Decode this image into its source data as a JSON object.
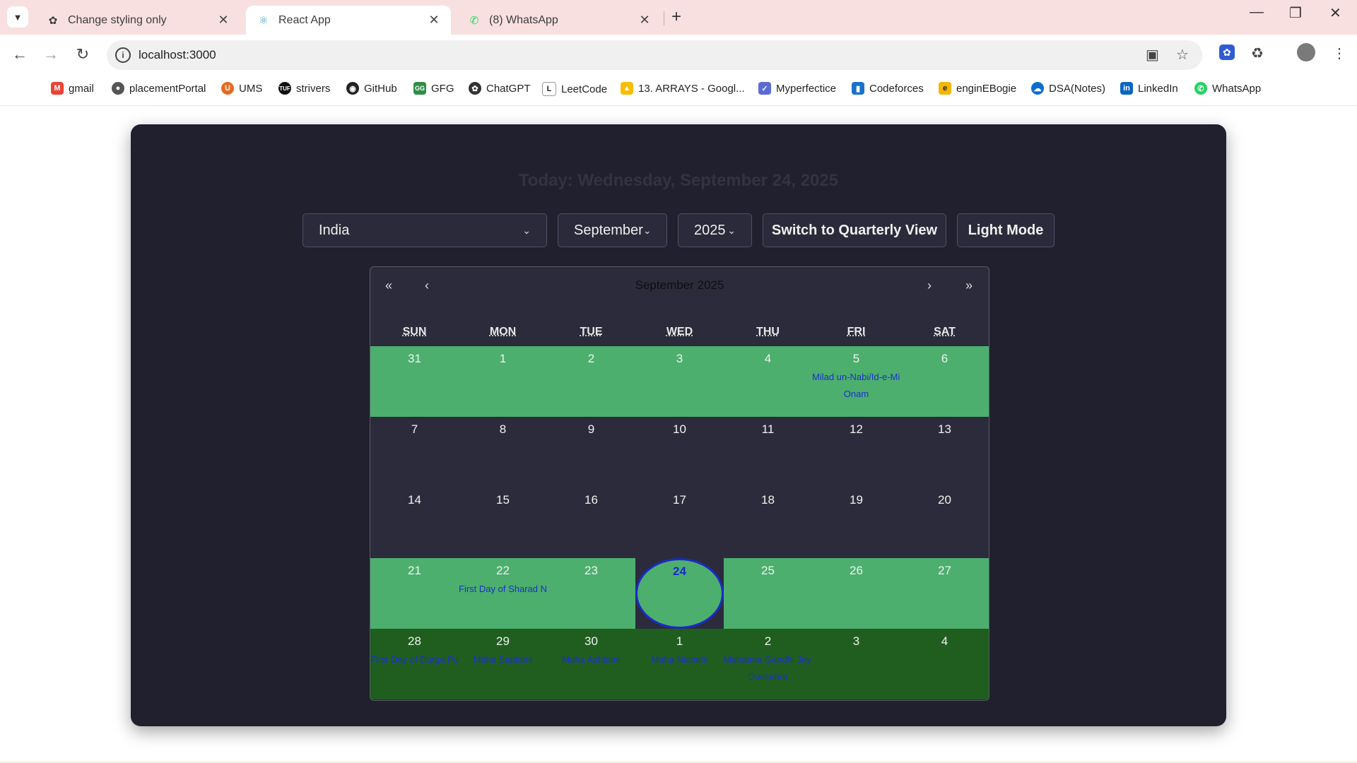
{
  "browser": {
    "tabs": [
      {
        "title": "Change styling only",
        "icon": "chatgpt-icon",
        "active": false
      },
      {
        "title": "React App",
        "icon": "react-icon",
        "active": true
      },
      {
        "title": "(8) WhatsApp",
        "icon": "whatsapp-icon",
        "active": false
      }
    ],
    "url": "localhost:3000",
    "bookmarks": [
      {
        "label": "gmail",
        "icon": "gmail-icon"
      },
      {
        "label": "placementPortal",
        "icon": "globe-icon"
      },
      {
        "label": "UMS",
        "icon": "ums-icon"
      },
      {
        "label": "strivers",
        "icon": "tuf-icon"
      },
      {
        "label": "GitHub",
        "icon": "github-icon"
      },
      {
        "label": "GFG",
        "icon": "gfg-icon"
      },
      {
        "label": "ChatGPT",
        "icon": "chatgpt-icon"
      },
      {
        "label": "LeetCode",
        "icon": "leetcode-icon"
      },
      {
        "label": "13. ARRAYS - Googl...",
        "icon": "google-drive-icon"
      },
      {
        "label": "Myperfectice",
        "icon": "myperfectice-icon"
      },
      {
        "label": "Codeforces",
        "icon": "codeforces-icon"
      },
      {
        "label": "enginEBogie",
        "icon": "enginebogie-icon"
      },
      {
        "label": "DSA(Notes)",
        "icon": "onedrive-icon"
      },
      {
        "label": "LinkedIn",
        "icon": "linkedin-icon"
      },
      {
        "label": "WhatsApp",
        "icon": "whatsapp-icon"
      }
    ]
  },
  "app": {
    "today_text": "Today: Wednesday, September 24, 2025",
    "country": "India",
    "month": "September",
    "year": "2025",
    "view_button": "Switch to Quarterly View",
    "theme_button": "Light Mode"
  },
  "calendar": {
    "title": "September 2025",
    "nav": {
      "prev_year": "«",
      "prev_month": "‹",
      "next_month": "›",
      "next_year": "»"
    },
    "weekdays": [
      "SUN",
      "MON",
      "TUE",
      "WED",
      "THU",
      "FRI",
      "SAT"
    ],
    "weeks": [
      {
        "style": "green",
        "days": [
          {
            "num": "31",
            "events": []
          },
          {
            "num": "1",
            "events": []
          },
          {
            "num": "2",
            "events": []
          },
          {
            "num": "3",
            "events": []
          },
          {
            "num": "4",
            "events": []
          },
          {
            "num": "5",
            "events": [
              "Milad un-Nabi/Id-e-Milad",
              "Onam"
            ]
          },
          {
            "num": "6",
            "events": []
          }
        ]
      },
      {
        "style": "plain",
        "days": [
          {
            "num": "7",
            "events": []
          },
          {
            "num": "8",
            "events": []
          },
          {
            "num": "9",
            "events": []
          },
          {
            "num": "10",
            "events": []
          },
          {
            "num": "11",
            "events": []
          },
          {
            "num": "12",
            "events": []
          },
          {
            "num": "13",
            "events": []
          }
        ]
      },
      {
        "style": "plain",
        "days": [
          {
            "num": "14",
            "events": []
          },
          {
            "num": "15",
            "events": []
          },
          {
            "num": "16",
            "events": []
          },
          {
            "num": "17",
            "events": []
          },
          {
            "num": "18",
            "events": []
          },
          {
            "num": "19",
            "events": []
          },
          {
            "num": "20",
            "events": []
          }
        ]
      },
      {
        "style": "green",
        "days": [
          {
            "num": "21",
            "events": []
          },
          {
            "num": "22",
            "events": [
              "First Day of Sharad Navratri"
            ]
          },
          {
            "num": "23",
            "events": []
          },
          {
            "num": "24",
            "events": [],
            "today": true
          },
          {
            "num": "25",
            "events": []
          },
          {
            "num": "26",
            "events": []
          },
          {
            "num": "27",
            "events": []
          }
        ]
      },
      {
        "style": "dark",
        "days": [
          {
            "num": "28",
            "events": [
              "First Day of Durga Puja Festivities"
            ]
          },
          {
            "num": "29",
            "events": [
              "Maha Saptami"
            ]
          },
          {
            "num": "30",
            "events": [
              "Maha Ashtami"
            ]
          },
          {
            "num": "1",
            "events": [
              "Maha Navami"
            ]
          },
          {
            "num": "2",
            "events": [
              "Mahatma Gandhi Jayanti",
              "Dussehra"
            ]
          },
          {
            "num": "3",
            "events": []
          },
          {
            "num": "4",
            "events": []
          }
        ]
      }
    ]
  }
}
